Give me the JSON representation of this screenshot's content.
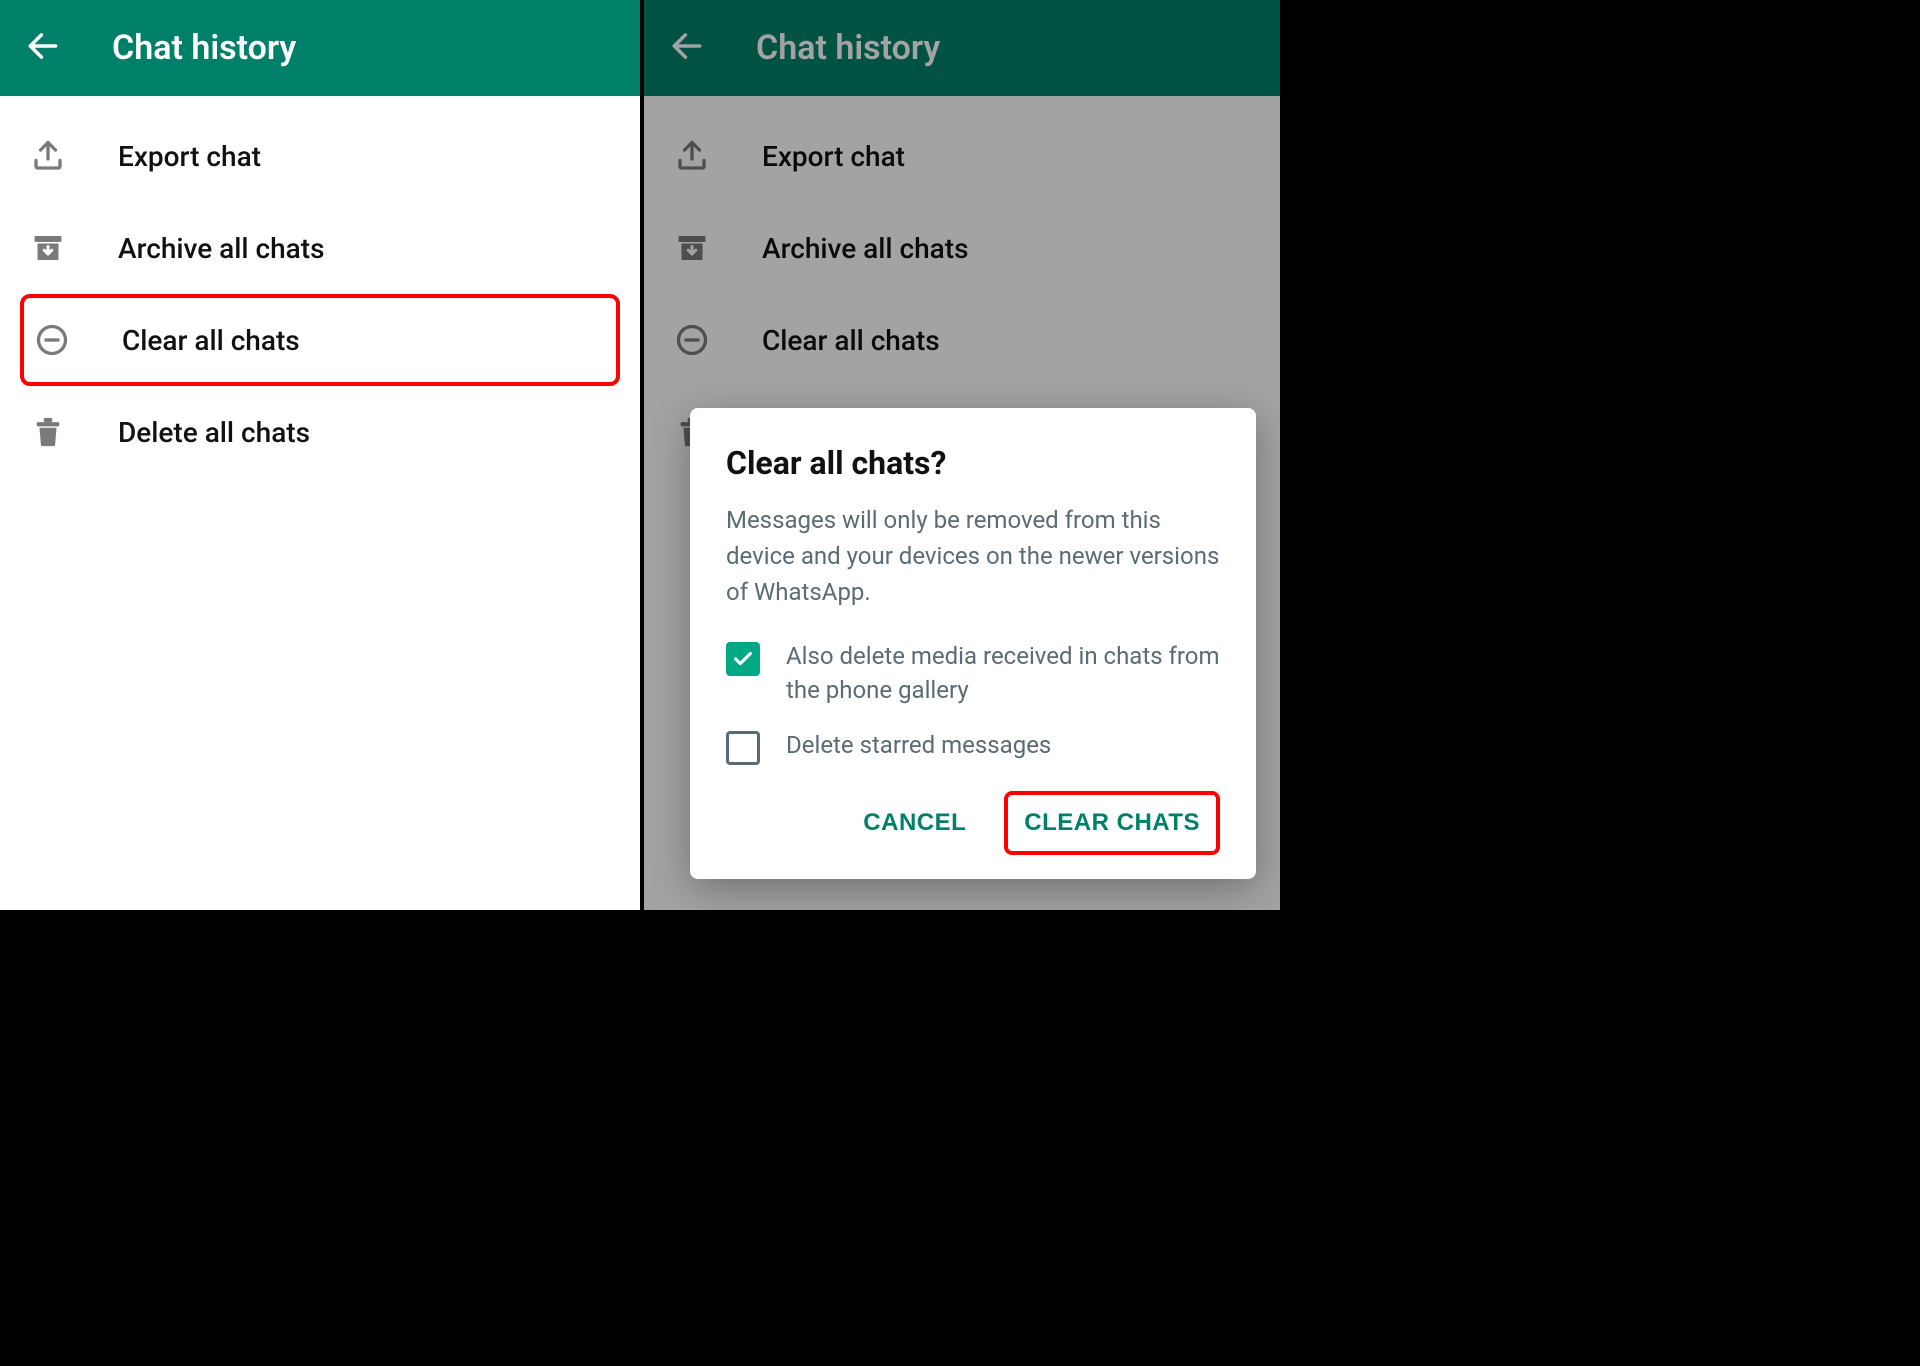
{
  "header": {
    "title": "Chat history"
  },
  "menu": {
    "export": "Export chat",
    "archive": "Archive all chats",
    "clear": "Clear all chats",
    "delete": "Delete all chats"
  },
  "dialog": {
    "title": "Clear all chats?",
    "body": "Messages will only be removed from this device and your devices on the newer versions of WhatsApp.",
    "opt_media": "Also delete media received in chats from the phone gallery",
    "opt_starred": "Delete starred messages",
    "cancel": "CANCEL",
    "confirm": "CLEAR CHATS"
  }
}
